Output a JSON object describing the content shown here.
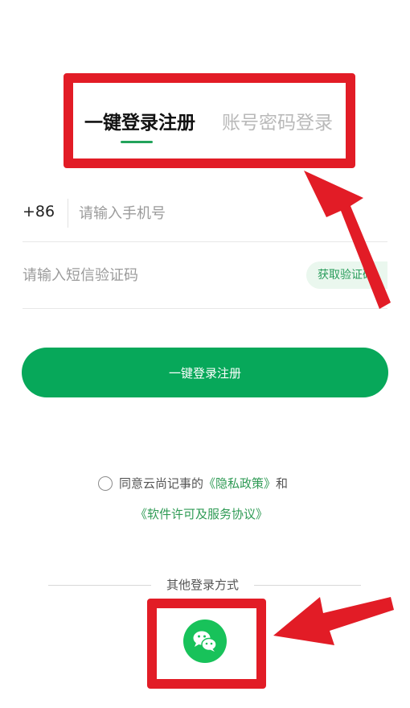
{
  "tabs": {
    "active_label": "一键登录注册",
    "inactive_label": "账号密码登录"
  },
  "phone_row": {
    "country_code": "+86",
    "phone_placeholder": "请输入手机号"
  },
  "code_row": {
    "code_placeholder": "请输入短信验证码",
    "get_code_label": "获取验证码"
  },
  "login_button_label": "一键登录注册",
  "agreement": {
    "prefix": "同意云尚记事的",
    "privacy_link": "《隐私政策》",
    "connector": "和",
    "license_link": "《软件许可及服务协议》"
  },
  "other_login": {
    "title": "其他登录方式",
    "wechat_icon": "wechat-icon"
  },
  "colors": {
    "accent": "#07a85a",
    "link": "#2f9b55",
    "annotation": "#e21c26"
  }
}
